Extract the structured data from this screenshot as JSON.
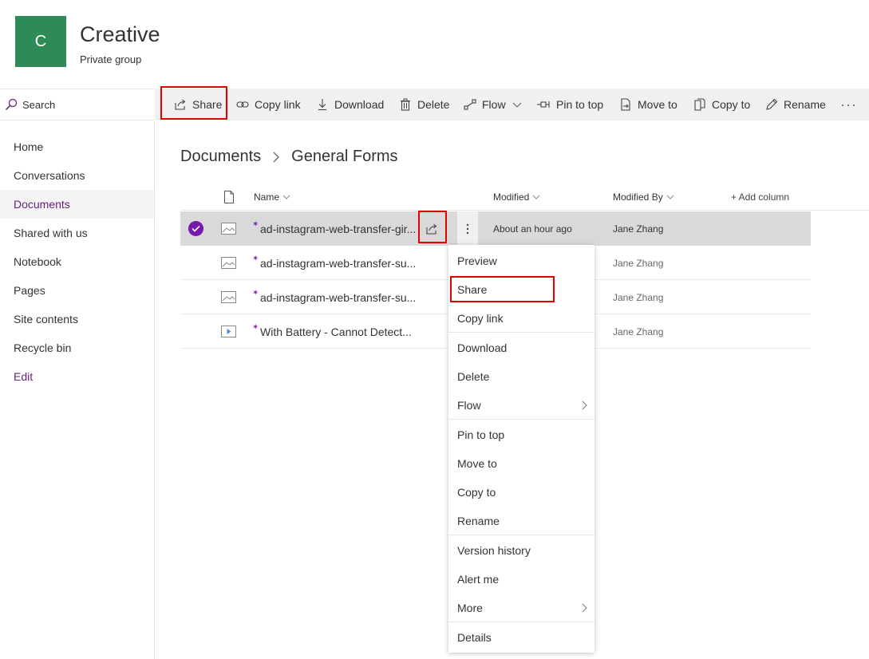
{
  "site": {
    "logo_letter": "C",
    "title": "Creative",
    "subtitle": "Private group",
    "brand_color": "#2e8b57",
    "accent_color": "#7719aa"
  },
  "search": {
    "label": "Search",
    "icon": "search-icon"
  },
  "nav": {
    "items": [
      {
        "label": "Home"
      },
      {
        "label": "Conversations"
      },
      {
        "label": "Documents",
        "active": true
      },
      {
        "label": "Shared with us"
      },
      {
        "label": "Notebook"
      },
      {
        "label": "Pages"
      },
      {
        "label": "Site contents"
      },
      {
        "label": "Recycle bin"
      }
    ],
    "edit_label": "Edit"
  },
  "command_bar": {
    "share": "Share",
    "copy_link": "Copy link",
    "download": "Download",
    "delete": "Delete",
    "flow": "Flow",
    "pin_to_top": "Pin to top",
    "move_to": "Move to",
    "copy_to": "Copy to",
    "rename": "Rename",
    "more": "···"
  },
  "breadcrumb": {
    "root": "Documents",
    "current": "General Forms"
  },
  "columns": {
    "name": "Name",
    "modified": "Modified",
    "modified_by": "Modified By",
    "add_column": "+ Add column"
  },
  "files": [
    {
      "name": "ad-instagram-web-transfer-gir...",
      "modified": "About an hour ago",
      "modified_by": "Jane Zhang",
      "type": "image",
      "selected": true
    },
    {
      "name": "ad-instagram-web-transfer-su...",
      "modified": "",
      "modified_by": "Jane Zhang",
      "type": "image"
    },
    {
      "name": "ad-instagram-web-transfer-su...",
      "modified": "",
      "modified_by": "Jane Zhang",
      "type": "image"
    },
    {
      "name": "With Battery - Cannot Detect...",
      "modified": "",
      "modified_by": "Jane Zhang",
      "type": "video"
    }
  ],
  "context_menu": {
    "preview": "Preview",
    "share": "Share",
    "copy_link": "Copy link",
    "download": "Download",
    "delete": "Delete",
    "flow": "Flow",
    "pin_to_top": "Pin to top",
    "move_to": "Move to",
    "copy_to": "Copy to",
    "rename": "Rename",
    "version_history": "Version history",
    "alert_me": "Alert me",
    "more": "More",
    "details": "Details"
  },
  "highlight_color": "#e00000"
}
